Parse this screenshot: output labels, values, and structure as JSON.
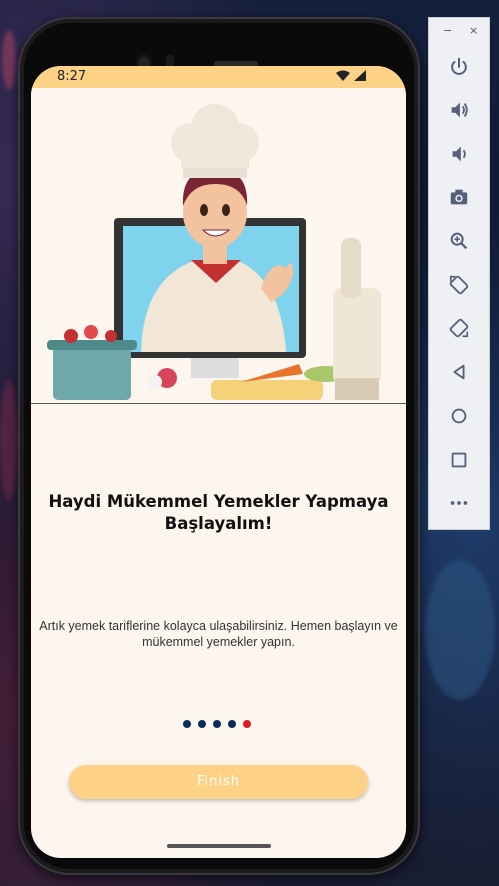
{
  "status_bar": {
    "time": "8:27"
  },
  "onboarding": {
    "title": "Haydi Mükemmel Yemekler Yapmaya Başlayalım!",
    "description": "Artık yemek tariflerine kolayca ulaşabilirsiniz. Hemen başlayın ve mükemmel yemekler yapın.",
    "page_count": 5,
    "active_page": 5,
    "finish_label": "Finish"
  },
  "colors": {
    "accent": "#fdd286",
    "dot": "#0d2a5e",
    "dot_active": "#e11b1b",
    "screen_bg": "#fdf6ee"
  },
  "emulator_panel": {
    "window_controls": [
      "minimize-icon",
      "close-icon"
    ],
    "minimize_glyph": "−",
    "close_glyph": "×",
    "buttons": [
      "power-icon",
      "volume-up-icon",
      "volume-down-icon",
      "camera-icon",
      "zoom-icon",
      "rotate-left-icon",
      "rotate-right-icon",
      "back-icon",
      "home-icon",
      "overview-icon",
      "more-icon"
    ]
  }
}
